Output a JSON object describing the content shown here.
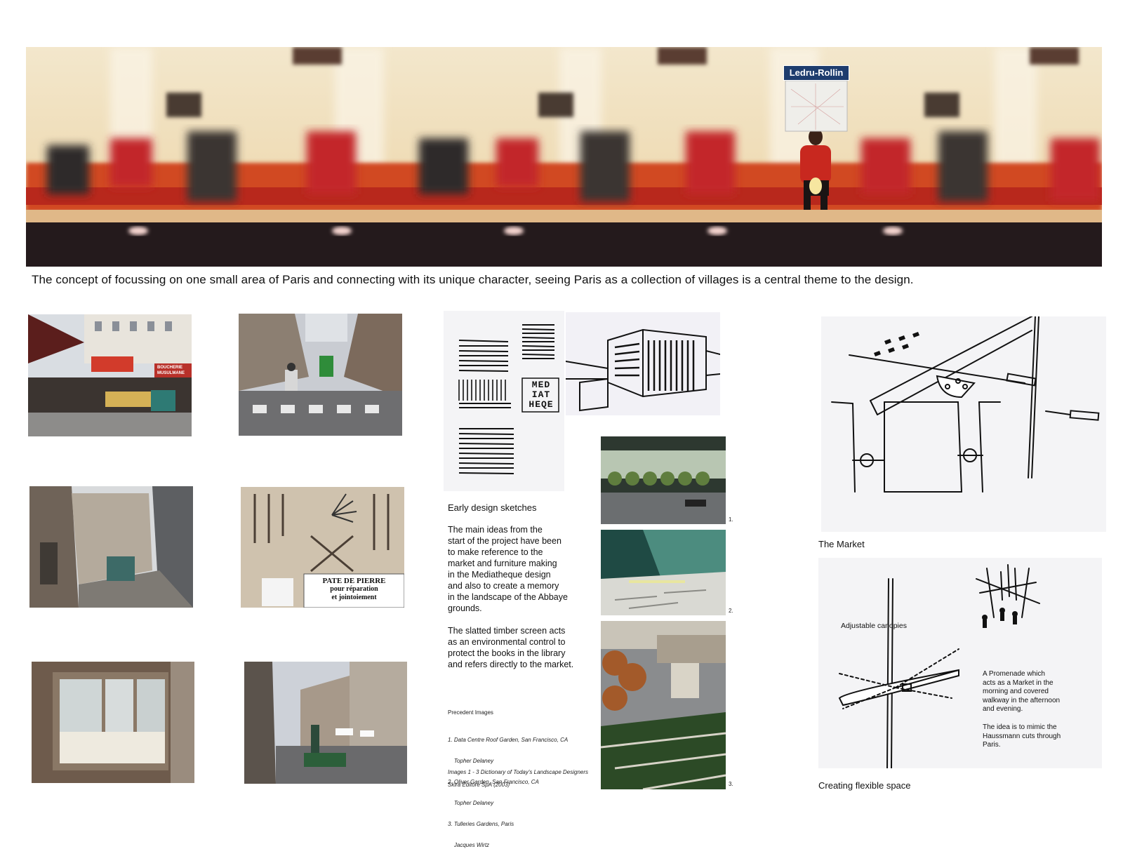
{
  "banner": {
    "sign_text": "Ledru-Rollin",
    "caption": "The concept of focussing on one small area of Paris and connecting with its unique character, seeing Paris as a collection of villages is a central theme to the design."
  },
  "photos": {
    "market_signs": "BOUCHERIE MUSULMANE",
    "stone_sign_line1": "PATE DE PIERRE",
    "stone_sign_line2": "pour réparation",
    "stone_sign_line3": "et jointoiement"
  },
  "sketches": {
    "mediatheque_letters": [
      "MED",
      "IAT",
      "HEQE"
    ],
    "heading": "Early design sketches",
    "para1_lines": [
      "The main ideas from the",
      "start of the project have been",
      "to make reference to the",
      "market and furniture making",
      "in the Mediatheque design",
      "and also to create a memory",
      "in the landscape of the Abbaye",
      "grounds."
    ],
    "para2_lines": [
      "The slatted timber screen acts",
      "as an environmental control to",
      "protect the books in the library",
      "and refers directly to the market."
    ]
  },
  "precedents": {
    "heading": "Precedent Images",
    "lines": [
      "1. Data Centre Roof Garden, San Francisco, CA",
      "    Topher Delaney",
      "2. Oliver Garden, San Francisco, CA",
      "    Topher Delaney",
      "3. Tulleries Gardens, Paris",
      "    Jacques Wirtz"
    ],
    "credit1": "Images 1 - 3 Dictionary of Today's Landscape Designers",
    "credit2": "Skira Editore SpA (2003)",
    "numbers": [
      "1.",
      "2.",
      "3."
    ]
  },
  "market": {
    "caption": "The Market"
  },
  "flexible": {
    "caption": "Creating flexible space",
    "label_canopies": "Adjustable canopies",
    "promenade_lines": [
      "A Promenade which",
      "acts as a Market in the",
      "morning and covered",
      "walkway in the afternoon",
      "and evening."
    ],
    "idea_lines": [
      "The idea is to mimic the",
      "Haussmann cuts through",
      "Paris."
    ]
  }
}
